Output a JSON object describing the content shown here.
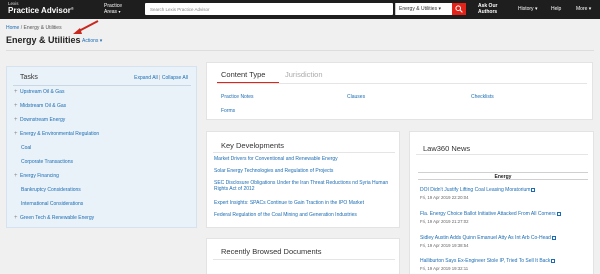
{
  "header": {
    "brand_top": "Lexis",
    "brand_main": "Practice Advisor",
    "brand_reg": "®",
    "practice_areas_line1": "Practice",
    "practice_areas_line2": "Areas",
    "search_placeholder": "Search Lexis Practice Advisor",
    "search_scope": "Energy & Utilities",
    "ask_line1": "Ask Our",
    "ask_line2": "Authors",
    "history": "History",
    "help": "Help",
    "more": "More"
  },
  "breadcrumb": {
    "home": "Home",
    "separator": "/",
    "current": "Energy & Utilities"
  },
  "page": {
    "title": "Energy & Utilities",
    "actions": "Actions"
  },
  "tasks": {
    "title": "Tasks",
    "expand_all": "Expand All",
    "separator": "|",
    "collapse_all": "Collapse All",
    "items": [
      {
        "label": "Upstream Oil & Gas",
        "expandable": true
      },
      {
        "label": "Midstream Oil & Gas",
        "expandable": true
      },
      {
        "label": "Downstream Energy",
        "expandable": true
      },
      {
        "label": "Energy & Environmental Regulation",
        "expandable": true
      },
      {
        "label": "Coal",
        "expandable": false
      },
      {
        "label": "Corporate Transactions",
        "expandable": false
      },
      {
        "label": "Energy Financing",
        "expandable": true
      },
      {
        "label": "Bankruptcy Considerations",
        "expandable": false
      },
      {
        "label": "International Considerations",
        "expandable": false
      },
      {
        "label": "Green Tech & Renewable Energy",
        "expandable": true
      }
    ]
  },
  "content": {
    "tab_content_type": "Content Type",
    "tab_jurisdiction": "Jurisdiction",
    "links": {
      "practice_notes": "Practice Notes",
      "clauses": "Clauses",
      "checklists": "Checklists",
      "forms": "Forms"
    }
  },
  "key_developments": {
    "title": "Key Developments",
    "items": [
      "Market Drivers for Conventional and Renewable Energy",
      "Solar Energy Technologies and Regulation of Projects",
      "SEC Disclosure Obligations Under the Iran Threat Reductions nd Syria Human Rights Act of 2012",
      "Expert Insights: SPACs Continue to Gain Traction in the IPO Market",
      "Federal Regulation of the Coal Mining and Generation Industries"
    ]
  },
  "recently_browsed": {
    "title": "Recently Browsed Documents"
  },
  "news": {
    "title": "Law360 News",
    "tab": "Energy",
    "items": [
      {
        "headline": "DOI Didn't Justify Lifting Coal Leasing Moratorium",
        "date": "Fri, 19 Apr 2019 22:20:04"
      },
      {
        "headline": "Fla. Energy Choice Ballot Initiative Attacked From All Corners",
        "date": "Fri, 19 Apr 2019 21:27:02"
      },
      {
        "headline": "Sidley Austin Adds Quinn Emanuel Atty As Int Arb Co-Head",
        "date": "Fri, 19 Apr 2019 19:38:54"
      },
      {
        "headline": "Halliburton Says Ex-Engineer Stole IP, Tried To Sell It Back",
        "date": "Fri, 19 Apr 2019 19:32:11"
      }
    ]
  },
  "colors": {
    "topbar": "#1e1e1e",
    "accent_red": "#e2231a",
    "link_blue": "#1a6bb3",
    "tasks_bg": "#eaf2f9"
  }
}
